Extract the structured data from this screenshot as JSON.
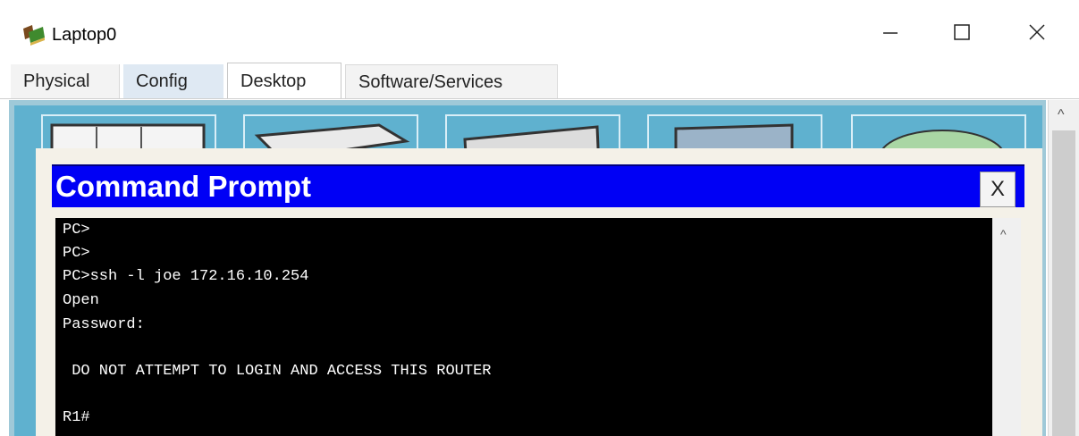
{
  "window": {
    "title": "Laptop0",
    "icon": "laptop-app-icon",
    "controls": [
      "minimize-icon",
      "maximize-icon",
      "close-icon"
    ]
  },
  "tabs": [
    {
      "label": "Physical"
    },
    {
      "label": "Config"
    },
    {
      "label": "Desktop",
      "active": true
    },
    {
      "label": "Software/Services"
    }
  ],
  "command_prompt": {
    "title": "Command Prompt",
    "close_label": "X",
    "lines": [
      "PC>",
      "PC>",
      "PC>ssh -l joe 172.16.10.254",
      "Open",
      "Password:",
      "",
      " DO NOT ATTEMPT TO LOGIN AND ACCESS THIS ROUTER",
      "",
      "R1#"
    ]
  },
  "colors": {
    "cmd_title_bg": "#0000f5",
    "terminal_bg": "#000000",
    "terminal_fg": "#ffffff",
    "desktop_bg": "#5fb1cf"
  }
}
